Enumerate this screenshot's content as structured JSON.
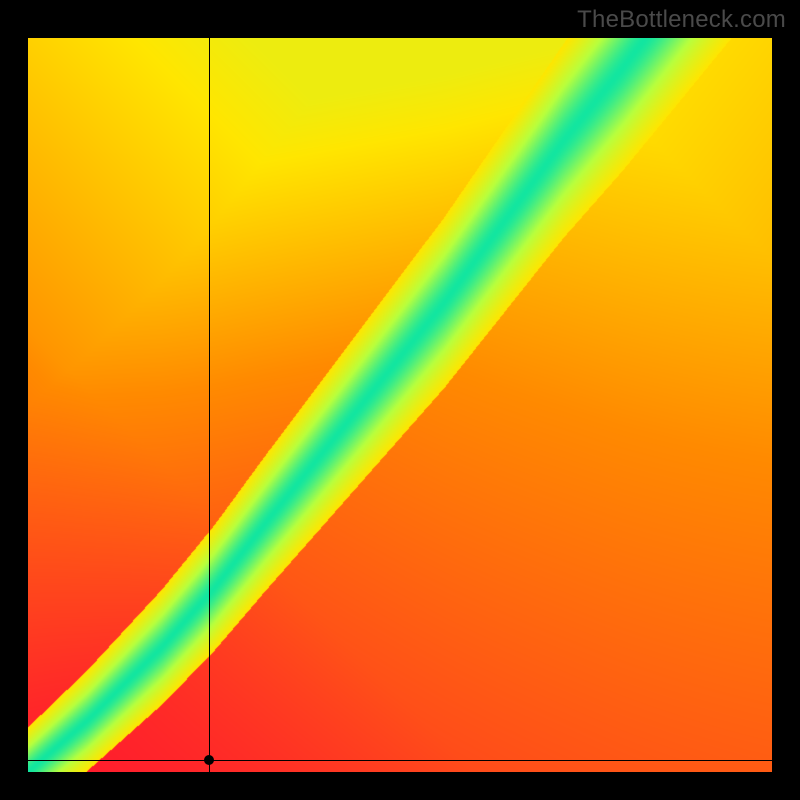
{
  "attribution": "TheBottleneck.com",
  "chart_data": {
    "type": "heatmap",
    "title": "",
    "xlabel": "",
    "ylabel": "",
    "x_range": [
      0,
      100
    ],
    "y_range": [
      0,
      100
    ],
    "legend": false,
    "grid": false,
    "marker": {
      "x": 24.3,
      "y": 1.6
    },
    "crosshair": {
      "x": 24.3,
      "y": 1.6
    },
    "colorscale": [
      {
        "t": 0.0,
        "color": "#ff1a2e"
      },
      {
        "t": 0.35,
        "color": "#ff8a00"
      },
      {
        "t": 0.55,
        "color": "#ffe600"
      },
      {
        "t": 0.75,
        "color": "#b8ff3d"
      },
      {
        "t": 1.0,
        "color": "#12e6a0"
      }
    ],
    "optimal_curve_xy": [
      [
        0,
        0
      ],
      [
        4,
        3.5
      ],
      [
        8,
        7
      ],
      [
        12,
        11
      ],
      [
        18,
        17
      ],
      [
        25,
        25
      ],
      [
        32,
        34
      ],
      [
        40,
        44
      ],
      [
        48,
        54
      ],
      [
        56,
        64
      ],
      [
        64,
        75
      ],
      [
        72,
        86
      ],
      [
        80,
        96
      ],
      [
        83,
        100
      ]
    ],
    "band_width_approx": 9
  }
}
